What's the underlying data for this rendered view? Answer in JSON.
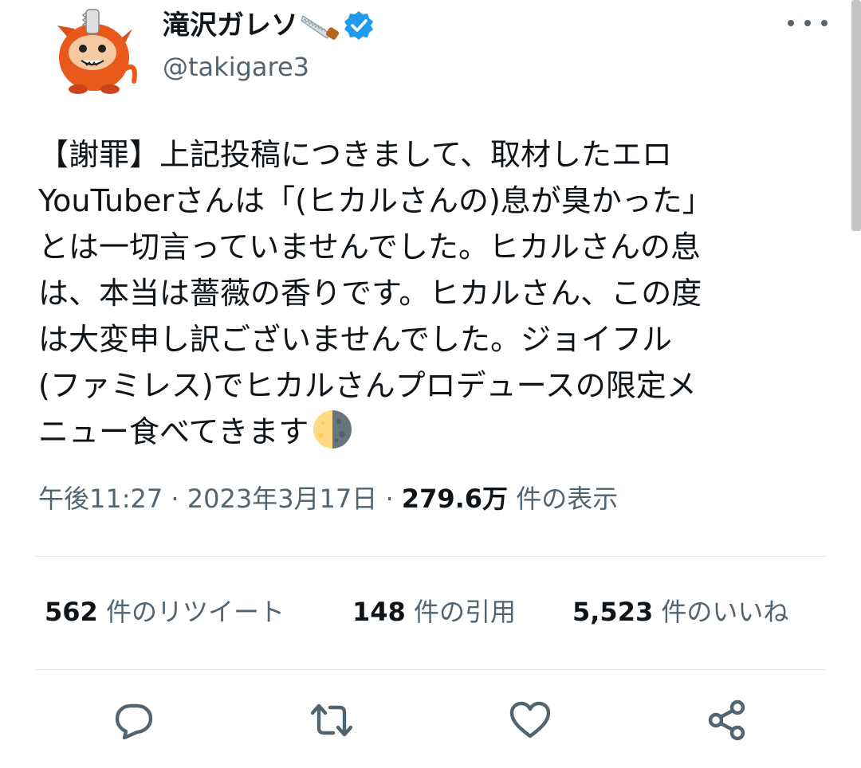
{
  "author": {
    "display_name": "滝沢ガレソ",
    "handle": "@takigare3",
    "name_emoji": "carpentry-saw",
    "verified": true,
    "badge_color": "#1d9bf0"
  },
  "tweet": {
    "lines": [
      "【謝罪】上記投稿につきまして、取材したエロ",
      "YouTuberさんは「(ヒカルさんの)息が臭かった」",
      "とは一切言っていませんでした。ヒカルさんの息",
      "は、本当は薔薇の香りです。ヒカルさん、この度",
      "は大変申し訳ございませんでした。ジョイフル",
      "(ファミレス)でヒカルさんプロデュースの限定メ",
      "ニュー食べてきます"
    ],
    "trailing_emoji": "last-quarter-moon-face"
  },
  "meta": {
    "time": "午後11:27",
    "separator": " · ",
    "date": "2023年3月17日",
    "views_count": "279.6万",
    "views_label": " 件の表示"
  },
  "stats": {
    "retweets": {
      "count": "562",
      "label": " 件のリツイート"
    },
    "quotes": {
      "count": "148",
      "label": " 件の引用"
    },
    "likes": {
      "count": "5,523",
      "label": " 件のいいね"
    }
  },
  "actions": [
    "reply-icon",
    "retweet-icon",
    "like-icon",
    "share-icon"
  ],
  "colors": {
    "text": "#0f1419",
    "secondary": "#536471",
    "divider": "#e6e9eb",
    "avatar_orange": "#e8591a"
  }
}
